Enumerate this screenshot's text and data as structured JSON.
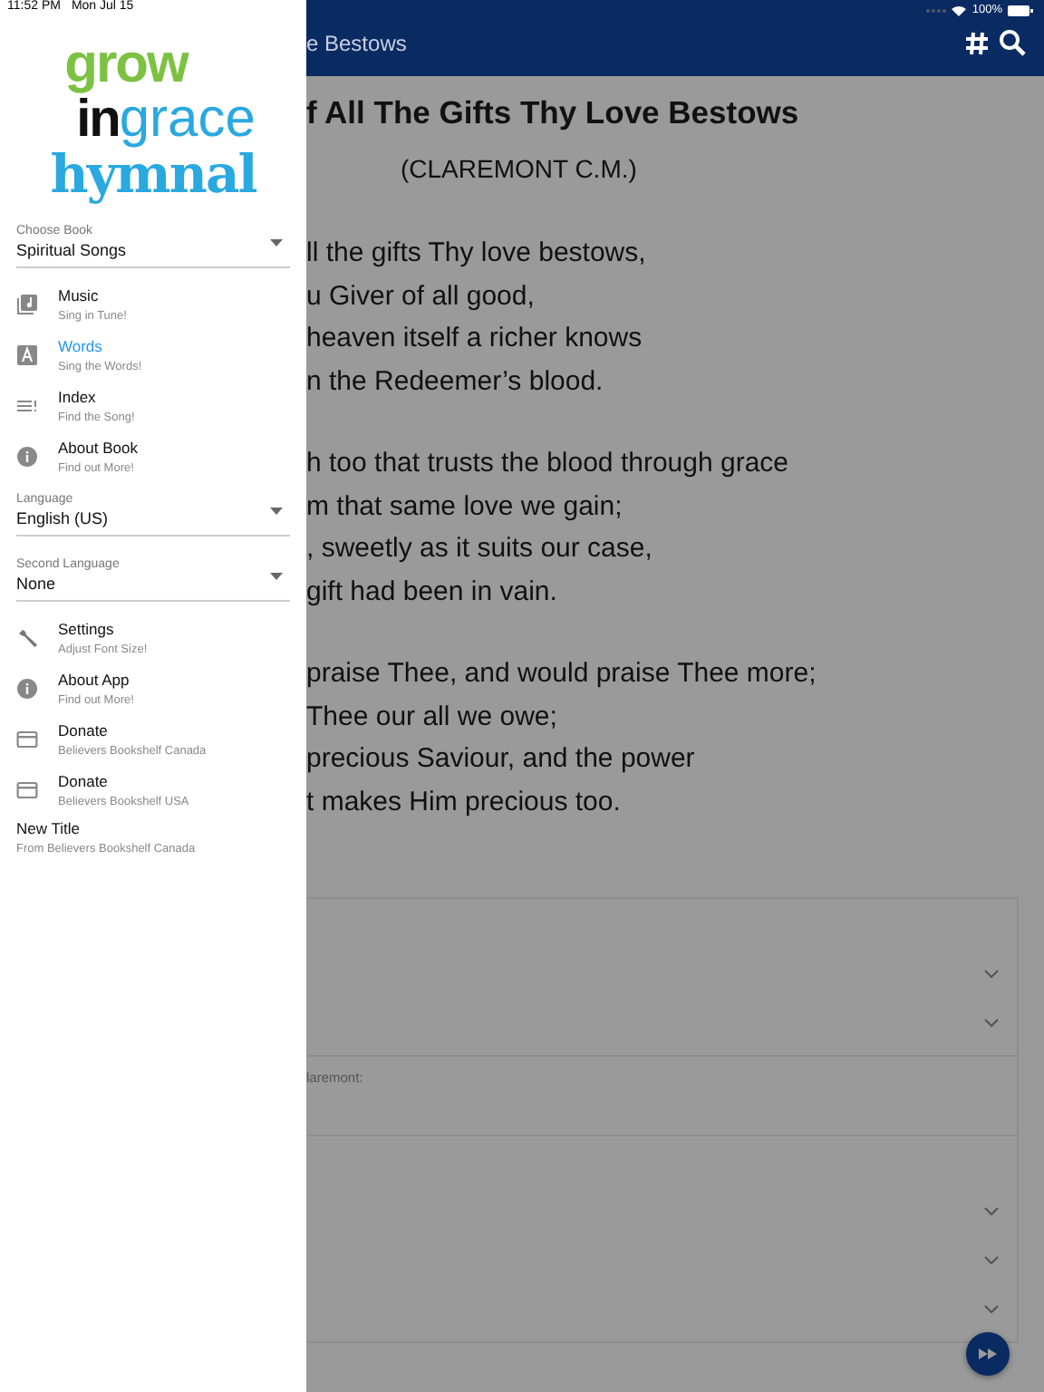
{
  "status_bar": {
    "time": "11:52 PM",
    "date": "Mon Jul 15",
    "battery": "100%"
  },
  "drawer": {
    "logo": {
      "grow": "grow",
      "in": "in",
      "grace": "grace",
      "hymnal": "hymnal"
    },
    "entries": [
      {
        "kind": "select",
        "label": "Choose Book",
        "value": "Spiritual Songs"
      },
      {
        "kind": "item",
        "title": "Music",
        "subtitle": "Sing in Tune!",
        "selected": false
      },
      {
        "kind": "item",
        "title": "Words",
        "subtitle": "Sing the Words!",
        "selected": true
      },
      {
        "kind": "item",
        "title": "Index",
        "subtitle": "Find the Song!",
        "selected": false
      },
      {
        "kind": "item",
        "title": "About Book",
        "subtitle": "Find out More!",
        "selected": false
      },
      {
        "kind": "select",
        "label": "Language",
        "value": "English (US)"
      },
      {
        "kind": "select",
        "label": "Second Language",
        "value": "None"
      },
      {
        "kind": "item",
        "title": "Settings",
        "subtitle": "Adjust Font Size!",
        "selected": false
      },
      {
        "kind": "item",
        "title": "About App",
        "subtitle": "Find out More!",
        "selected": false
      },
      {
        "kind": "item",
        "title": "Donate",
        "subtitle": "Believers Bookshelf Canada",
        "selected": false
      },
      {
        "kind": "item",
        "title": "Donate",
        "subtitle": "Believers Bookshelf USA",
        "selected": false
      },
      {
        "kind": "plain",
        "title": "New Title",
        "subtitle": "From Believers Bookshelf Canada"
      }
    ]
  },
  "app_bar": {
    "title": "e Bestows"
  },
  "hymn": {
    "title": "f All The Gifts Thy Love Bestows",
    "tune": "(CLAREMONT C.M.)",
    "stanzas": [
      [
        "ll the gifts Thy love bestows,",
        "u Giver of all good,",
        "heaven itself a richer knows",
        "n the Redeemer’s blood."
      ],
      [
        "h too that trusts the blood through grace",
        "m that same love we gain;",
        ", sweetly as it suits our case,",
        "gift had been in vain."
      ],
      [
        "praise Thee, and would praise Thee more;",
        "Thee our all we owe;",
        "precious Saviour, and the power",
        "t makes Him precious too."
      ]
    ]
  },
  "panels": [
    {
      "kind": "dropdowns",
      "fields": [
        {
          "expanded": false
        },
        {
          "expanded": false
        }
      ]
    },
    {
      "kind": "note",
      "text": "laremont:"
    },
    {
      "kind": "dropdowns",
      "fields": [
        {
          "expanded": false
        },
        {
          "expanded": false
        },
        {
          "expanded": false
        }
      ]
    }
  ]
}
